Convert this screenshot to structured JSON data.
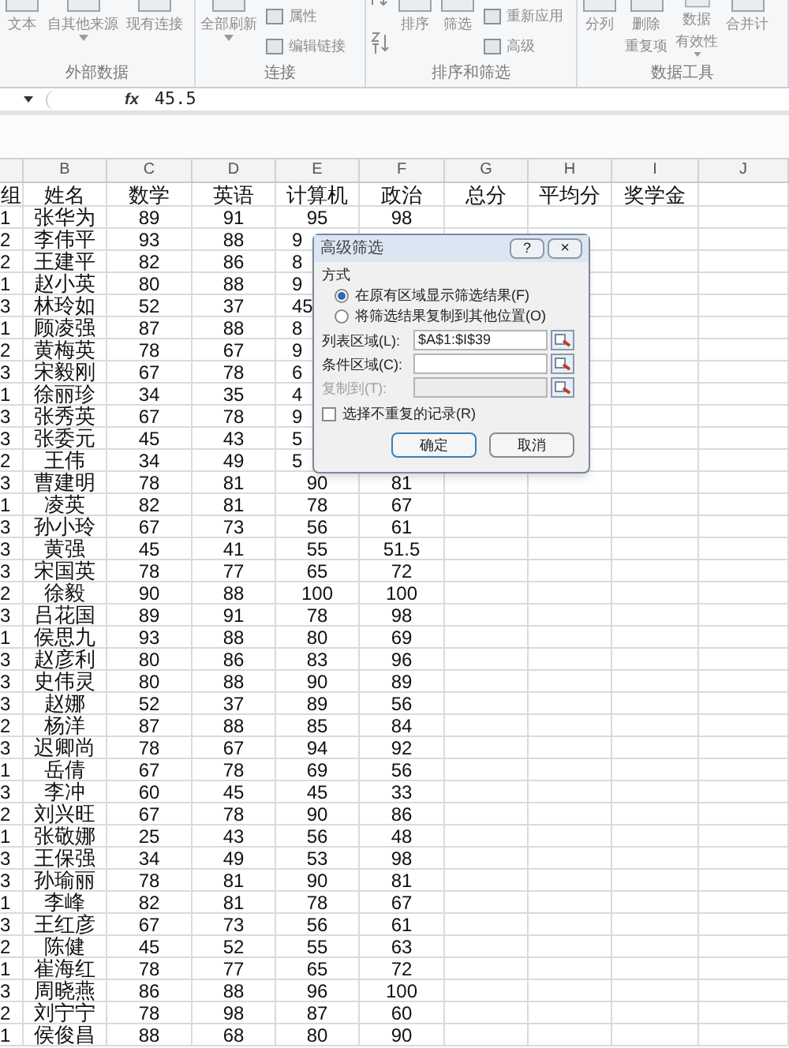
{
  "ribbon": {
    "groups": [
      {
        "label": "外部数据",
        "buttons": [
          {
            "kind": "large",
            "lines": [
              "文本"
            ]
          },
          {
            "kind": "large",
            "lines": [
              "自其他来源"
            ],
            "dropdown": true
          },
          {
            "kind": "large",
            "lines": [
              "现有连接"
            ]
          }
        ]
      },
      {
        "label": "连接",
        "buttons": [
          {
            "kind": "large",
            "lines": [
              "全部刷新"
            ],
            "dropdown": true
          },
          {
            "kind": "small",
            "lines": [
              "属性"
            ]
          },
          {
            "kind": "small",
            "lines": [
              "编辑链接"
            ]
          }
        ]
      },
      {
        "label": "排序和筛选",
        "buttons": [
          {
            "kind": "sort"
          },
          {
            "kind": "large",
            "lines": [
              "排序"
            ]
          },
          {
            "kind": "large",
            "lines": [
              "筛选"
            ]
          },
          {
            "kind": "small",
            "lines": [
              "重新应用"
            ]
          },
          {
            "kind": "small",
            "lines": [
              "高级"
            ]
          }
        ]
      },
      {
        "label": "数据工具",
        "buttons": [
          {
            "kind": "large",
            "lines": [
              "分列"
            ]
          },
          {
            "kind": "large",
            "lines": [
              "删除",
              "重复项"
            ]
          },
          {
            "kind": "large",
            "lines": [
              "数据",
              "有效性"
            ],
            "dropdown": true
          },
          {
            "kind": "large",
            "lines": [
              "合并计"
            ]
          }
        ]
      }
    ]
  },
  "formula_bar": {
    "function_symbol": "fx",
    "value": "45.5"
  },
  "sheet": {
    "column_letters": [
      "B",
      "C",
      "D",
      "E",
      "F",
      "G",
      "H",
      "I",
      "J"
    ],
    "headers": [
      "组",
      "姓名",
      "数学",
      "英语",
      "计算机",
      "政治",
      "总分",
      "平均分",
      "奖学金"
    ],
    "rows": [
      {
        "cells": [
          "1",
          "张华为",
          "89",
          "91",
          "95",
          "98"
        ]
      },
      {
        "cells": [
          "2",
          "李伟平",
          "93",
          "88",
          "9"
        ],
        "partly_hidden": true
      },
      {
        "cells": [
          "2",
          "王建平",
          "82",
          "86",
          "8"
        ],
        "partly_hidden": true
      },
      {
        "cells": [
          "1",
          "赵小英",
          "80",
          "88",
          "9"
        ],
        "partly_hidden": true
      },
      {
        "cells": [
          "3",
          "林玲如",
          "52",
          "37",
          "45"
        ],
        "partly_hidden": true
      },
      {
        "cells": [
          "1",
          "顾凌强",
          "87",
          "88",
          "8"
        ],
        "partly_hidden": true
      },
      {
        "cells": [
          "2",
          "黄梅英",
          "78",
          "67",
          "9"
        ],
        "partly_hidden": true
      },
      {
        "cells": [
          "3",
          "宋毅刚",
          "67",
          "78",
          "6"
        ],
        "partly_hidden": true
      },
      {
        "cells": [
          "1",
          "徐丽珍",
          "34",
          "35",
          "4"
        ],
        "partly_hidden": true
      },
      {
        "cells": [
          "3",
          "张秀英",
          "67",
          "78",
          "9"
        ],
        "partly_hidden": true
      },
      {
        "cells": [
          "3",
          "张委元",
          "45",
          "43",
          "5"
        ],
        "partly_hidden": true
      },
      {
        "cells": [
          "2",
          "王伟",
          "34",
          "49",
          "5"
        ],
        "partly_hidden": true
      },
      {
        "cells": [
          "3",
          "曹建明",
          "78",
          "81",
          "90",
          "81"
        ]
      },
      {
        "cells": [
          "1",
          "凌英",
          "82",
          "81",
          "78",
          "67"
        ]
      },
      {
        "cells": [
          "3",
          "孙小玲",
          "67",
          "73",
          "56",
          "61"
        ]
      },
      {
        "cells": [
          "3",
          "黄强",
          "45",
          "41",
          "55",
          "51.5"
        ]
      },
      {
        "cells": [
          "3",
          "宋国英",
          "78",
          "77",
          "65",
          "72"
        ]
      },
      {
        "cells": [
          "2",
          "徐毅",
          "90",
          "88",
          "100",
          "100"
        ]
      },
      {
        "cells": [
          "3",
          "吕花国",
          "89",
          "91",
          "78",
          "98"
        ]
      },
      {
        "cells": [
          "1",
          "侯思九",
          "93",
          "88",
          "80",
          "69"
        ]
      },
      {
        "cells": [
          "3",
          "赵彦利",
          "80",
          "86",
          "83",
          "96"
        ]
      },
      {
        "cells": [
          "3",
          "史伟灵",
          "80",
          "88",
          "90",
          "89"
        ]
      },
      {
        "cells": [
          "3",
          "赵娜",
          "52",
          "37",
          "89",
          "56"
        ]
      },
      {
        "cells": [
          "2",
          "杨洋",
          "87",
          "88",
          "85",
          "84"
        ]
      },
      {
        "cells": [
          "3",
          "迟卿尚",
          "78",
          "67",
          "94",
          "92"
        ]
      },
      {
        "cells": [
          "1",
          "岳倩",
          "67",
          "78",
          "69",
          "56"
        ]
      },
      {
        "cells": [
          "3",
          "李冲",
          "60",
          "45",
          "45",
          "33"
        ]
      },
      {
        "cells": [
          "2",
          "刘兴旺",
          "67",
          "78",
          "90",
          "86"
        ]
      },
      {
        "cells": [
          "1",
          "张敬娜",
          "25",
          "43",
          "56",
          "48"
        ]
      },
      {
        "cells": [
          "3",
          "王保强",
          "34",
          "49",
          "53",
          "98"
        ]
      },
      {
        "cells": [
          "3",
          "孙瑜丽",
          "78",
          "81",
          "90",
          "81"
        ]
      },
      {
        "cells": [
          "1",
          "李峰",
          "82",
          "81",
          "78",
          "67"
        ]
      },
      {
        "cells": [
          "3",
          "王红彦",
          "67",
          "73",
          "56",
          "61"
        ]
      },
      {
        "cells": [
          "2",
          "陈健",
          "45",
          "52",
          "55",
          "63"
        ]
      },
      {
        "cells": [
          "1",
          "崔海红",
          "78",
          "77",
          "65",
          "72"
        ]
      },
      {
        "cells": [
          "3",
          "周晓燕",
          "86",
          "88",
          "96",
          "100"
        ]
      },
      {
        "cells": [
          "2",
          "刘宁宁",
          "78",
          "98",
          "87",
          "60"
        ]
      },
      {
        "cells": [
          "1",
          "侯俊昌",
          "88",
          "68",
          "80",
          "90"
        ]
      }
    ]
  },
  "dialog": {
    "title": "高级筛选",
    "help": "?",
    "close": "×",
    "section": "方式",
    "options": [
      {
        "label": "在原有区域显示筛选结果(F)",
        "selected": true
      },
      {
        "label": "将筛选结果复制到其他位置(O)",
        "selected": false
      }
    ],
    "fields": [
      {
        "label": "列表区域(L):",
        "value": "$A$1:$I$39",
        "disabled": false
      },
      {
        "label": "条件区域(C):",
        "disabled": false
      },
      {
        "label": "复制到(T):",
        "disabled": true
      }
    ],
    "unique_checkbox": {
      "label": "选择不重复的记录(R)",
      "checked": false
    },
    "buttons": [
      "确定",
      "取消"
    ]
  }
}
